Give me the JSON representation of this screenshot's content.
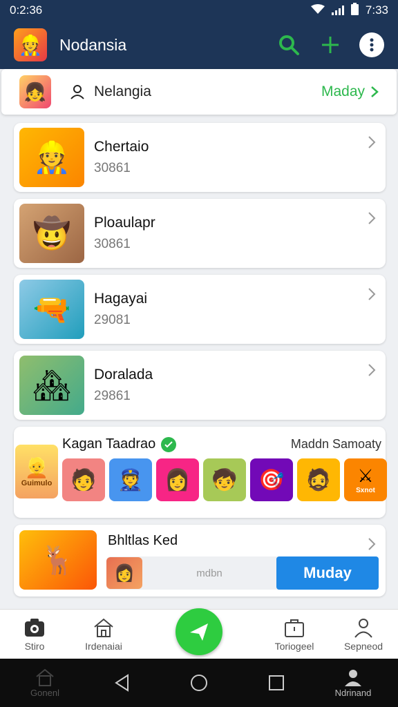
{
  "status_bar": {
    "time": "0:2:36",
    "clock_right": "7:33"
  },
  "app_bar": {
    "title": "Nodansia",
    "actions": [
      "search-icon",
      "plus-icon",
      "more-vertical-icon"
    ]
  },
  "user_bar": {
    "name": "Nelangia",
    "action_label": "Maday"
  },
  "items": [
    {
      "title": "Chertaio",
      "subtitle": "30861",
      "icon": "miner-avatar"
    },
    {
      "title": "Ploaulapr",
      "subtitle": "30861",
      "icon": "hunter-avatar"
    },
    {
      "title": "Hagayai",
      "subtitle": "29081",
      "icon": "cannon-icon"
    },
    {
      "title": "Doralada",
      "subtitle": "29861",
      "icon": "village-scene"
    }
  ],
  "featured": {
    "title": "Kagan Taadrao",
    "right_label": "Maddn Samoaty",
    "first_tile_label": "Guimulo",
    "last_tile_label": "Sxnot"
  },
  "promo": {
    "title": "Bhltlas Ked",
    "input_text": "mdbn",
    "button_label": "Muday"
  },
  "bottom_nav": [
    {
      "label": "Stiro",
      "icon": "camera-icon"
    },
    {
      "label": "Irdenaiai",
      "icon": "home-icon"
    },
    {
      "label": "Toriogeel",
      "icon": "bag-icon"
    },
    {
      "label": "Sepneod",
      "icon": "person-icon"
    }
  ],
  "system_nav": {
    "left_label": "Gonenl",
    "right_label": "Ndrinand"
  },
  "colors": {
    "primary_dark": "#1d3557",
    "accent_green": "#2db84d",
    "button_blue": "#1f88e5",
    "fab_green": "#2ecc40"
  }
}
